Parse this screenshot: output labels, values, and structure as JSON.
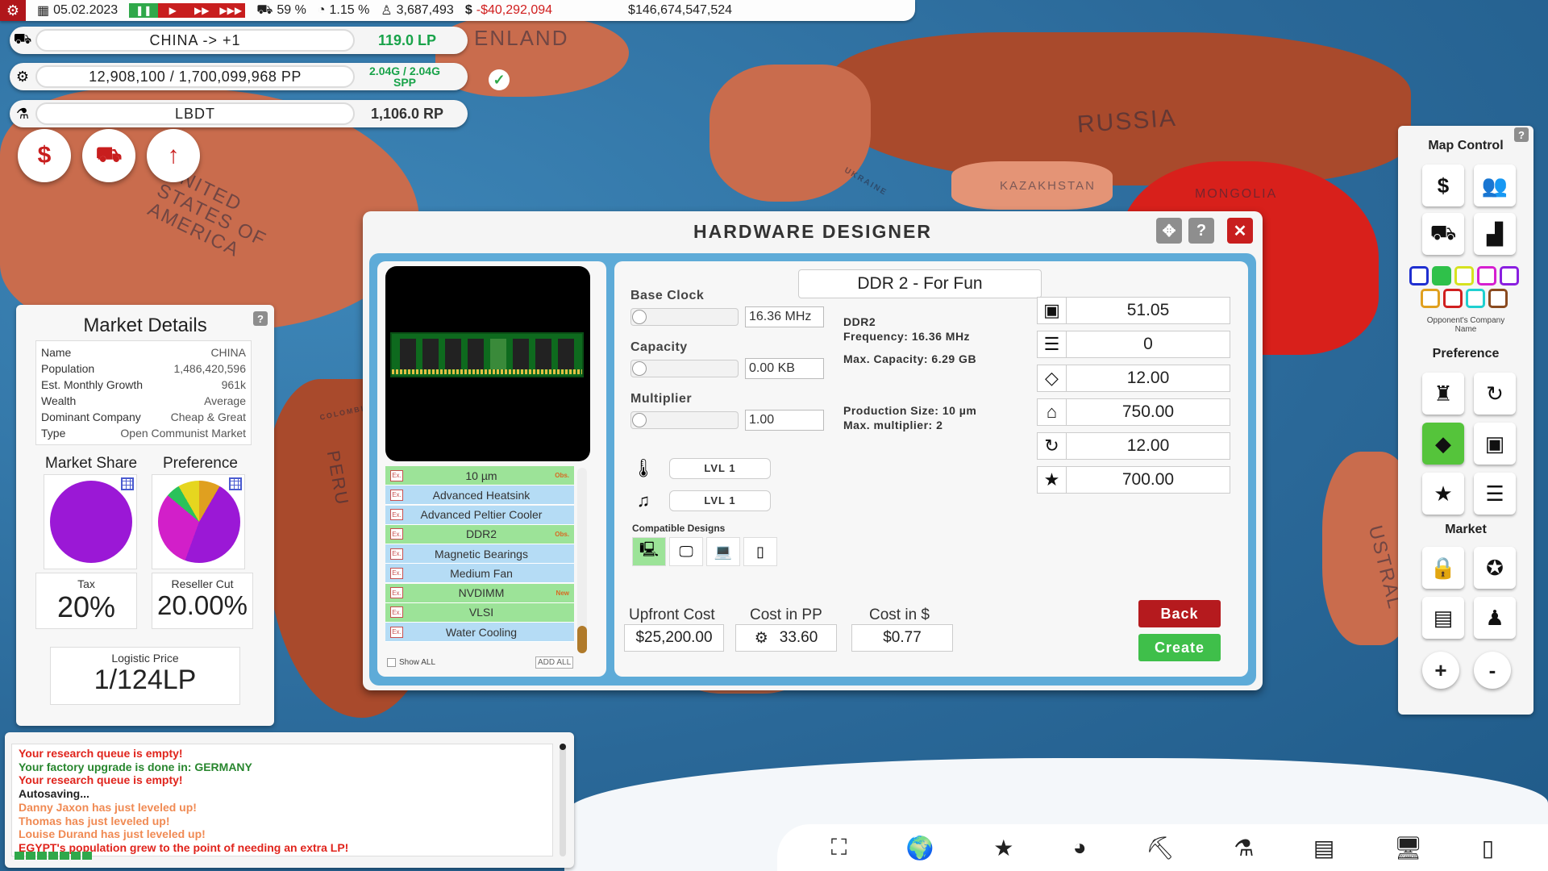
{
  "topbar": {
    "date": "05.02.2023",
    "percent": "59 %",
    "rate": "1.15 %",
    "people": "3,687,493",
    "balance": "-$40,292,094",
    "networth": "$146,674,547,524"
  },
  "pills": [
    {
      "label": "CHINA -> +1",
      "value": "119.0 LP",
      "icon": "truck-icon"
    },
    {
      "label": "12,908,100 / 1,700,099,968 PP",
      "value": "2.04G / 2.04G SPP",
      "icon": "gear-icon"
    },
    {
      "label": "LBDT",
      "value": "1,106.0 RP",
      "icon": "microscope-icon"
    }
  ],
  "round_buttons": [
    "$",
    "⛟",
    "↑"
  ],
  "map_labels": {
    "greenland": "ENLAND",
    "russia": "RUSSIA",
    "kazakhstan": "KAZAKHSTAN",
    "mongolia": "MONGOLIA",
    "usa": "UNITED STATES OF AMERICA",
    "peru": "PERU",
    "colombia": "COLOMBIA",
    "ukraine": "UKRAINE",
    "australia": "USTRAL"
  },
  "market": {
    "title": "Market Details",
    "rows": [
      {
        "k": "Name",
        "v": "CHINA"
      },
      {
        "k": "Population",
        "v": "1,486,420,596"
      },
      {
        "k": "Est. Monthly Growth",
        "v": "961k"
      },
      {
        "k": "Wealth",
        "v": "Average"
      },
      {
        "k": "Dominant Company",
        "v": "Cheap & Great"
      },
      {
        "k": "Type",
        "v": "Open Communist Market"
      }
    ],
    "share_label": "Market Share",
    "pref_label": "Preference",
    "tax_label": "Tax",
    "tax": "20%",
    "reseller_label": "Reseller Cut",
    "reseller": "20.00%",
    "logistic_label": "Logistic Price",
    "logistic": "1/124LP"
  },
  "log": [
    {
      "t": "Your research queue is empty!",
      "c": "c-red"
    },
    {
      "t": "Your factory upgrade is done in: GERMANY",
      "c": "c-green"
    },
    {
      "t": "Your research queue is empty!",
      "c": "c-red"
    },
    {
      "t": "Autosaving...",
      "c": "c-dark"
    },
    {
      "t": "Danny Jaxon has just leveled up!",
      "c": "c-orange"
    },
    {
      "t": "Thomas has just leveled up!",
      "c": "c-orange"
    },
    {
      "t": "Louise Durand has just leveled up!",
      "c": "c-orange"
    },
    {
      "t": "EGYPT's population grew to the point of needing an extra LP!",
      "c": "c-red"
    }
  ],
  "designer": {
    "title": "HARDWARE DESIGNER",
    "name": "DDR 2 - For Fun",
    "components": [
      {
        "name": "10 µm",
        "style": "g",
        "tag": "Obs."
      },
      {
        "name": "Advanced Heatsink",
        "style": "b",
        "tag": ""
      },
      {
        "name": "Advanced Peltier Cooler",
        "style": "b",
        "tag": ""
      },
      {
        "name": "DDR2",
        "style": "g",
        "tag": "Obs."
      },
      {
        "name": "Magnetic Bearings",
        "style": "b",
        "tag": ""
      },
      {
        "name": "Medium Fan",
        "style": "b",
        "tag": ""
      },
      {
        "name": "NVDIMM",
        "style": "g",
        "tag": "New"
      },
      {
        "name": "VLSI",
        "style": "g",
        "tag": ""
      },
      {
        "name": "Water Cooling",
        "style": "b",
        "tag": ""
      }
    ],
    "ex_label": "Ex.",
    "show_all": "Show ALL",
    "add_all": "ADD ALL",
    "base_clock_label": "Base Clock",
    "base_clock": "16.36 MHz",
    "capacity_label": "Capacity",
    "capacity": "0.00 KB",
    "multiplier_label": "Multiplier",
    "multiplier": "1.00",
    "info1": "DDR2\nFrequency: 16.36 MHz",
    "info2": "Max. Capacity: 6.29 GB",
    "info3": "Production Size: 10 µm\nMax. multiplier: 2",
    "lvl_temp": "LVL 1",
    "lvl_noise": "LVL  1",
    "compat_label": "Compatible Designs",
    "stats": [
      {
        "icon": "cpu-icon",
        "v": "51.05"
      },
      {
        "icon": "database-icon",
        "v": "0"
      },
      {
        "icon": "diamond-icon",
        "v": "12.00"
      },
      {
        "icon": "factory-icon",
        "v": "750.00"
      },
      {
        "icon": "cycle-icon",
        "v": "12.00"
      },
      {
        "icon": "star-icon",
        "v": "700.00"
      }
    ],
    "upfront_label": "Upfront Cost",
    "upfront": "$25,200.00",
    "pp_label": "Cost in PP",
    "pp": "33.60",
    "dollar_label": "Cost in $",
    "dollar": "$0.77",
    "back": "Back",
    "create": "Create"
  },
  "mapctl": {
    "title": "Map Control",
    "opp_label": "Opponent's Company Name",
    "pref": "Preference",
    "market": "Market",
    "swatches": [
      "#1f2fd0",
      "#2fc14a",
      "#d6e21f",
      "#d61fd0",
      "#8a1fe0",
      "#e0a01f",
      "#d01f1f",
      "#1fd0d0",
      "#8a4a1f"
    ]
  }
}
